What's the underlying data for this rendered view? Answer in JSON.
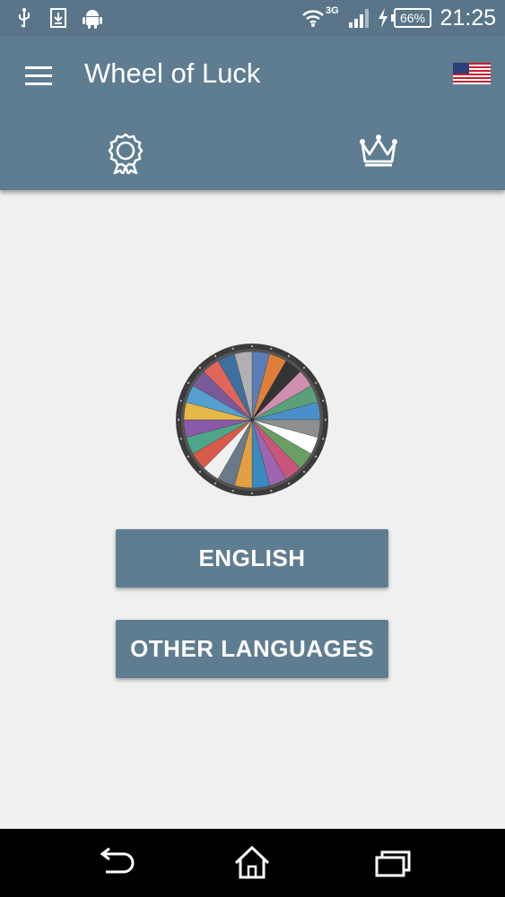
{
  "status_bar": {
    "time": "21:25",
    "battery": "66%",
    "network": "3G",
    "icons": [
      "usb-icon",
      "download-icon",
      "android-icon",
      "wifi-icon",
      "signal-icon",
      "charging-icon",
      "battery-icon"
    ]
  },
  "app_bar": {
    "title": "Wheel of Luck",
    "menu_icon": "hamburger-menu-icon",
    "language_icon": "us-flag-icon",
    "tabs": [
      {
        "icon": "award-ribbon-icon"
      },
      {
        "icon": "crown-icon"
      }
    ]
  },
  "main": {
    "wheel_icon": "spinning-wheel-icon",
    "buttons": {
      "english": "ENGLISH",
      "other_languages": "OTHER LANGUAGES"
    }
  },
  "nav_bar": {
    "icons": [
      "back-icon",
      "home-icon",
      "recent-apps-icon"
    ]
  },
  "colors": {
    "primary": "#5f7d91",
    "status_bar": "#5a7589",
    "background": "#f0f0f0",
    "nav_bar": "#000000"
  }
}
